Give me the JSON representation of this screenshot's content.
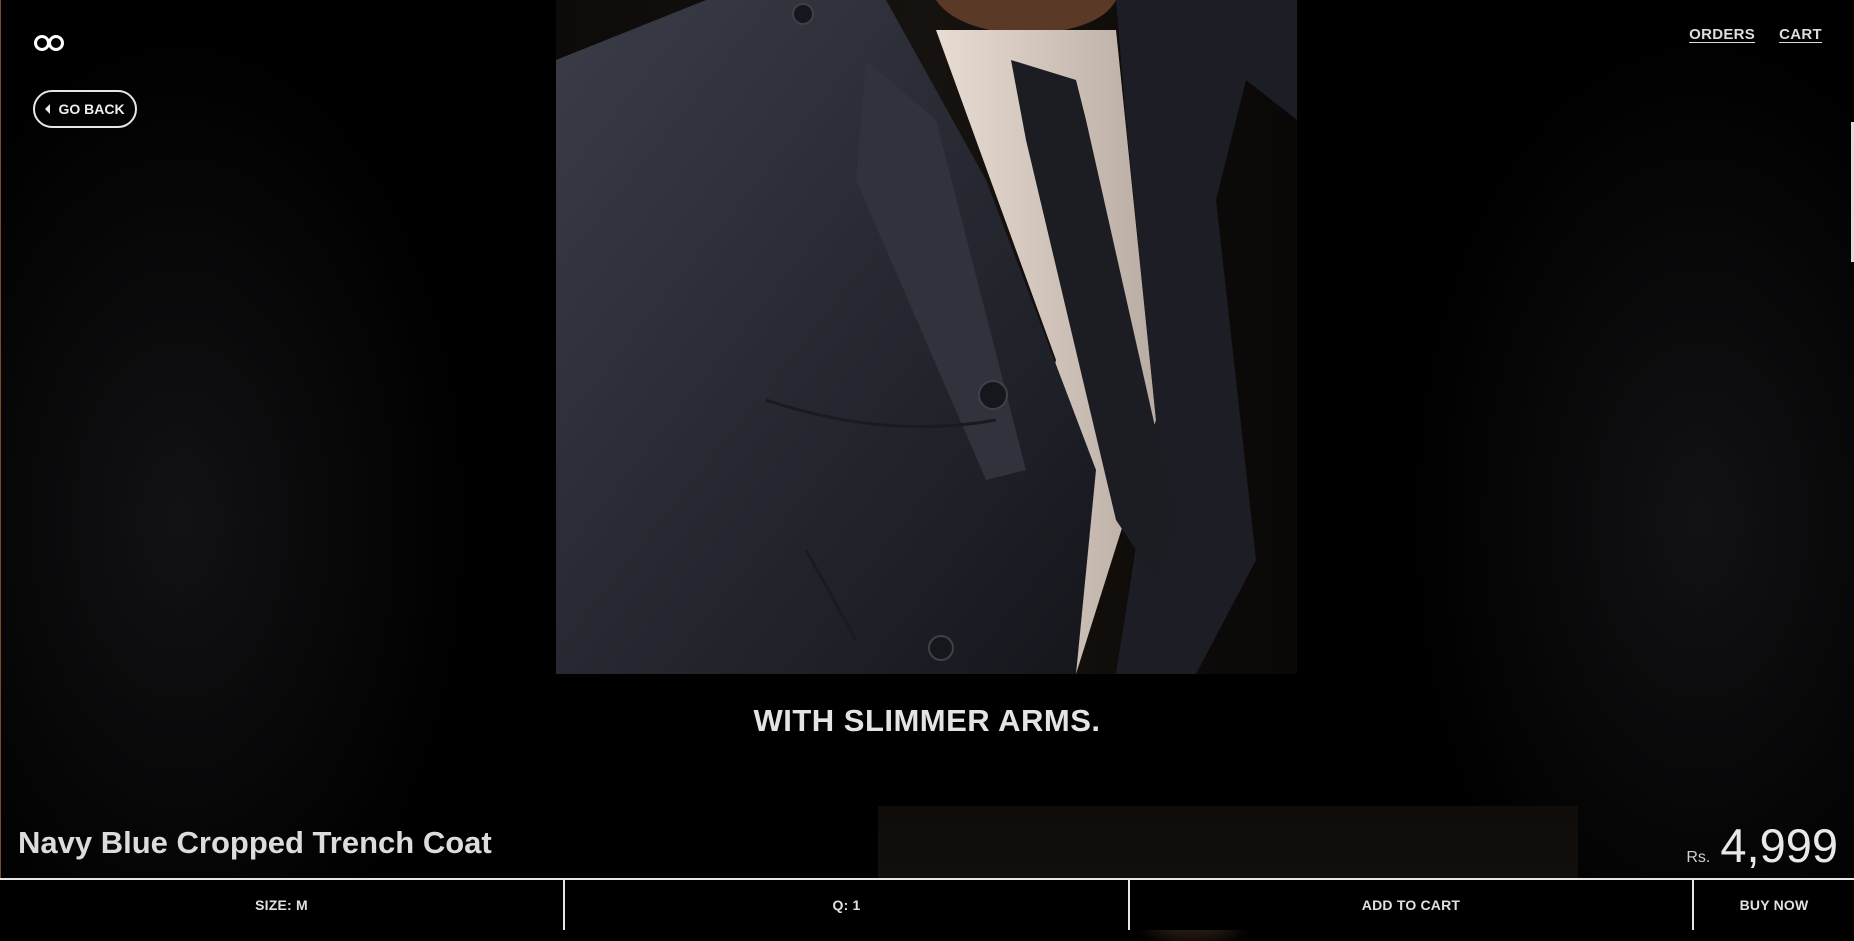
{
  "header": {
    "logo_icon": "infinity-logo-icon",
    "nav": {
      "orders": "ORDERS",
      "cart": "CART"
    },
    "go_back": "GO BACK"
  },
  "gallery": {
    "caption": "WITH SLIMMER ARMS."
  },
  "product": {
    "title": "Navy Blue Cropped Trench Coat",
    "currency": "Rs.",
    "price": "4,999"
  },
  "actions": {
    "size": "SIZE: M",
    "quantity": "Q: 1",
    "add_to_cart": "ADD TO CART",
    "buy_now": "BUY NOW"
  },
  "colors": {
    "background": "#000000",
    "text": "#e8e8e8",
    "coat": "#2a2c35",
    "shirt": "#d8ccc4"
  }
}
